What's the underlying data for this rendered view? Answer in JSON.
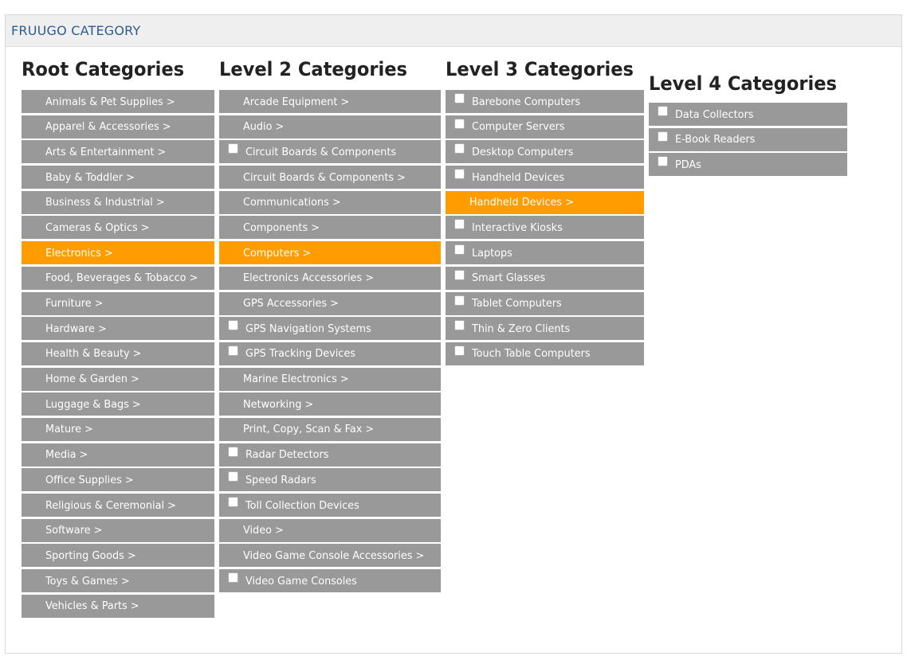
{
  "header": {
    "title": "FRUUGO CATEGORY"
  },
  "root": {
    "heading": "Root Categories",
    "items": [
      {
        "label": "Animals & Pet Supplies >",
        "type": "arrow"
      },
      {
        "label": "Apparel & Accessories >",
        "type": "arrow"
      },
      {
        "label": "Arts & Entertainment >",
        "type": "arrow"
      },
      {
        "label": "Baby & Toddler >",
        "type": "arrow"
      },
      {
        "label": "Business & Industrial >",
        "type": "arrow"
      },
      {
        "label": "Cameras & Optics >",
        "type": "arrow"
      },
      {
        "label": "Electronics >",
        "type": "arrow",
        "selected": true
      },
      {
        "label": "Food, Beverages & Tobacco >",
        "type": "arrow"
      },
      {
        "label": "Furniture >",
        "type": "arrow"
      },
      {
        "label": "Hardware >",
        "type": "arrow"
      },
      {
        "label": "Health & Beauty >",
        "type": "arrow"
      },
      {
        "label": "Home & Garden >",
        "type": "arrow"
      },
      {
        "label": "Luggage & Bags >",
        "type": "arrow"
      },
      {
        "label": "Mature >",
        "type": "arrow"
      },
      {
        "label": "Media >",
        "type": "arrow"
      },
      {
        "label": "Office Supplies >",
        "type": "arrow"
      },
      {
        "label": "Religious & Ceremonial >",
        "type": "arrow"
      },
      {
        "label": "Software >",
        "type": "arrow"
      },
      {
        "label": "Sporting Goods >",
        "type": "arrow"
      },
      {
        "label": "Toys & Games >",
        "type": "arrow"
      },
      {
        "label": "Vehicles & Parts >",
        "type": "arrow"
      }
    ]
  },
  "level2": {
    "heading": "Level 2 Categories",
    "items": [
      {
        "label": "Arcade Equipment >",
        "type": "arrow"
      },
      {
        "label": "Audio >",
        "type": "arrow"
      },
      {
        "label": "Circuit Boards & Components",
        "type": "check"
      },
      {
        "label": "Circuit Boards & Components >",
        "type": "arrow"
      },
      {
        "label": "Communications >",
        "type": "arrow"
      },
      {
        "label": "Components >",
        "type": "arrow"
      },
      {
        "label": "Computers >",
        "type": "arrow",
        "selected": true
      },
      {
        "label": "Electronics Accessories >",
        "type": "arrow"
      },
      {
        "label": "GPS Accessories >",
        "type": "arrow"
      },
      {
        "label": "GPS Navigation Systems",
        "type": "check"
      },
      {
        "label": "GPS Tracking Devices",
        "type": "check"
      },
      {
        "label": "Marine Electronics >",
        "type": "arrow"
      },
      {
        "label": "Networking >",
        "type": "arrow"
      },
      {
        "label": "Print, Copy, Scan & Fax >",
        "type": "arrow"
      },
      {
        "label": "Radar Detectors",
        "type": "check"
      },
      {
        "label": "Speed Radars",
        "type": "check"
      },
      {
        "label": "Toll Collection Devices",
        "type": "check"
      },
      {
        "label": "Video >",
        "type": "arrow"
      },
      {
        "label": "Video Game Console Accessories >",
        "type": "arrow"
      },
      {
        "label": "Video Game Consoles",
        "type": "check"
      }
    ]
  },
  "level3": {
    "heading": "Level 3 Categories",
    "items": [
      {
        "label": "Barebone Computers",
        "type": "check"
      },
      {
        "label": "Computer Servers",
        "type": "check"
      },
      {
        "label": "Desktop Computers",
        "type": "check"
      },
      {
        "label": "Handheld Devices",
        "type": "check"
      },
      {
        "label": "Handheld Devices >",
        "type": "arrow",
        "selected": true
      },
      {
        "label": "Interactive Kiosks",
        "type": "check"
      },
      {
        "label": "Laptops",
        "type": "check"
      },
      {
        "label": "Smart Glasses",
        "type": "check"
      },
      {
        "label": "Tablet Computers",
        "type": "check"
      },
      {
        "label": "Thin & Zero Clients",
        "type": "check"
      },
      {
        "label": "Touch Table Computers",
        "type": "check"
      }
    ]
  },
  "level4": {
    "heading": "Level 4 Categories",
    "items": [
      {
        "label": "Data Collectors",
        "type": "check"
      },
      {
        "label": "E-Book Readers",
        "type": "check"
      },
      {
        "label": "PDAs",
        "type": "check"
      }
    ]
  },
  "colors": {
    "item_bg": "#999999",
    "selected_bg": "#ff9c00",
    "header_text": "#2e5b91"
  }
}
